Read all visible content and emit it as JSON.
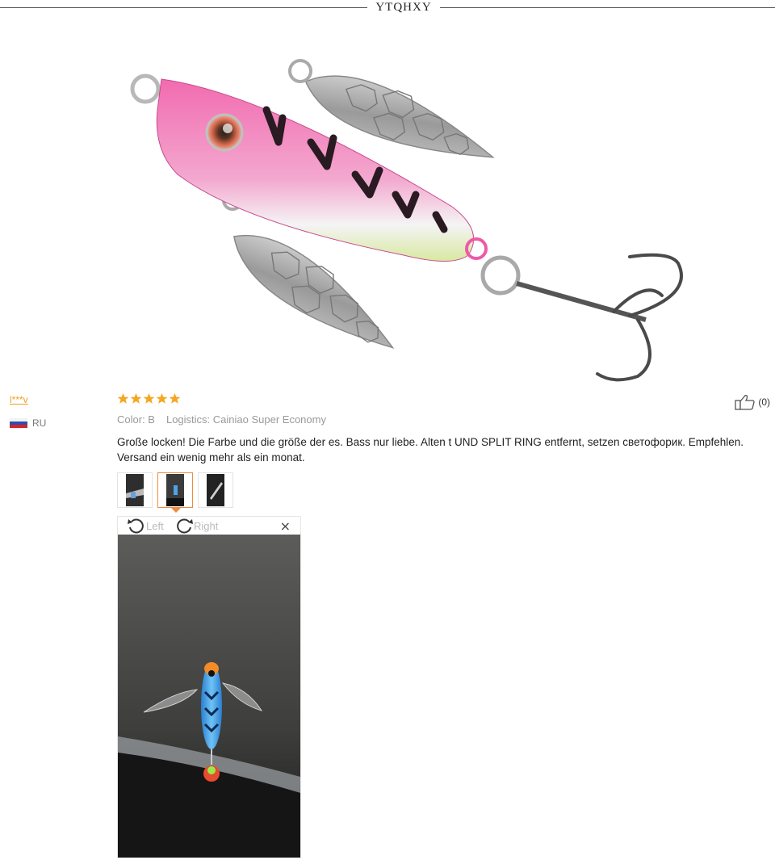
{
  "brand": {
    "name": "YTQHXY"
  },
  "review": {
    "user": "l***v",
    "country": "RU",
    "rating": 5,
    "color": "Color: B",
    "logistics": "Logistics: Cainiao Super Economy",
    "text": "Große locken! Die Farbe und die größe der es. Bass nur liebe. Alten t UND SPLIT RING entfernt, setzen светофорик. Empfehlen. Versand ein wenig mehr als ein monat.",
    "helpful_count": "(0)",
    "thumbnails": [
      "photo-1",
      "photo-2",
      "photo-3"
    ],
    "active_thumbnail": 2
  },
  "viewer": {
    "rotate_left_label": "Left",
    "rotate_right_label": "Right",
    "close_label": "×"
  },
  "icons": {
    "star": "star-icon",
    "thumbs_up": "thumbs-up-icon",
    "rotate_left": "rotate-left-icon",
    "rotate_right": "rotate-right-icon",
    "close": "close-icon",
    "flag": "russia-flag-icon"
  },
  "colors": {
    "star": "#f5a623",
    "username": "#f0a020",
    "thumb_active_border": "#f08a3c",
    "lure_pink": "#ee5aa6"
  }
}
